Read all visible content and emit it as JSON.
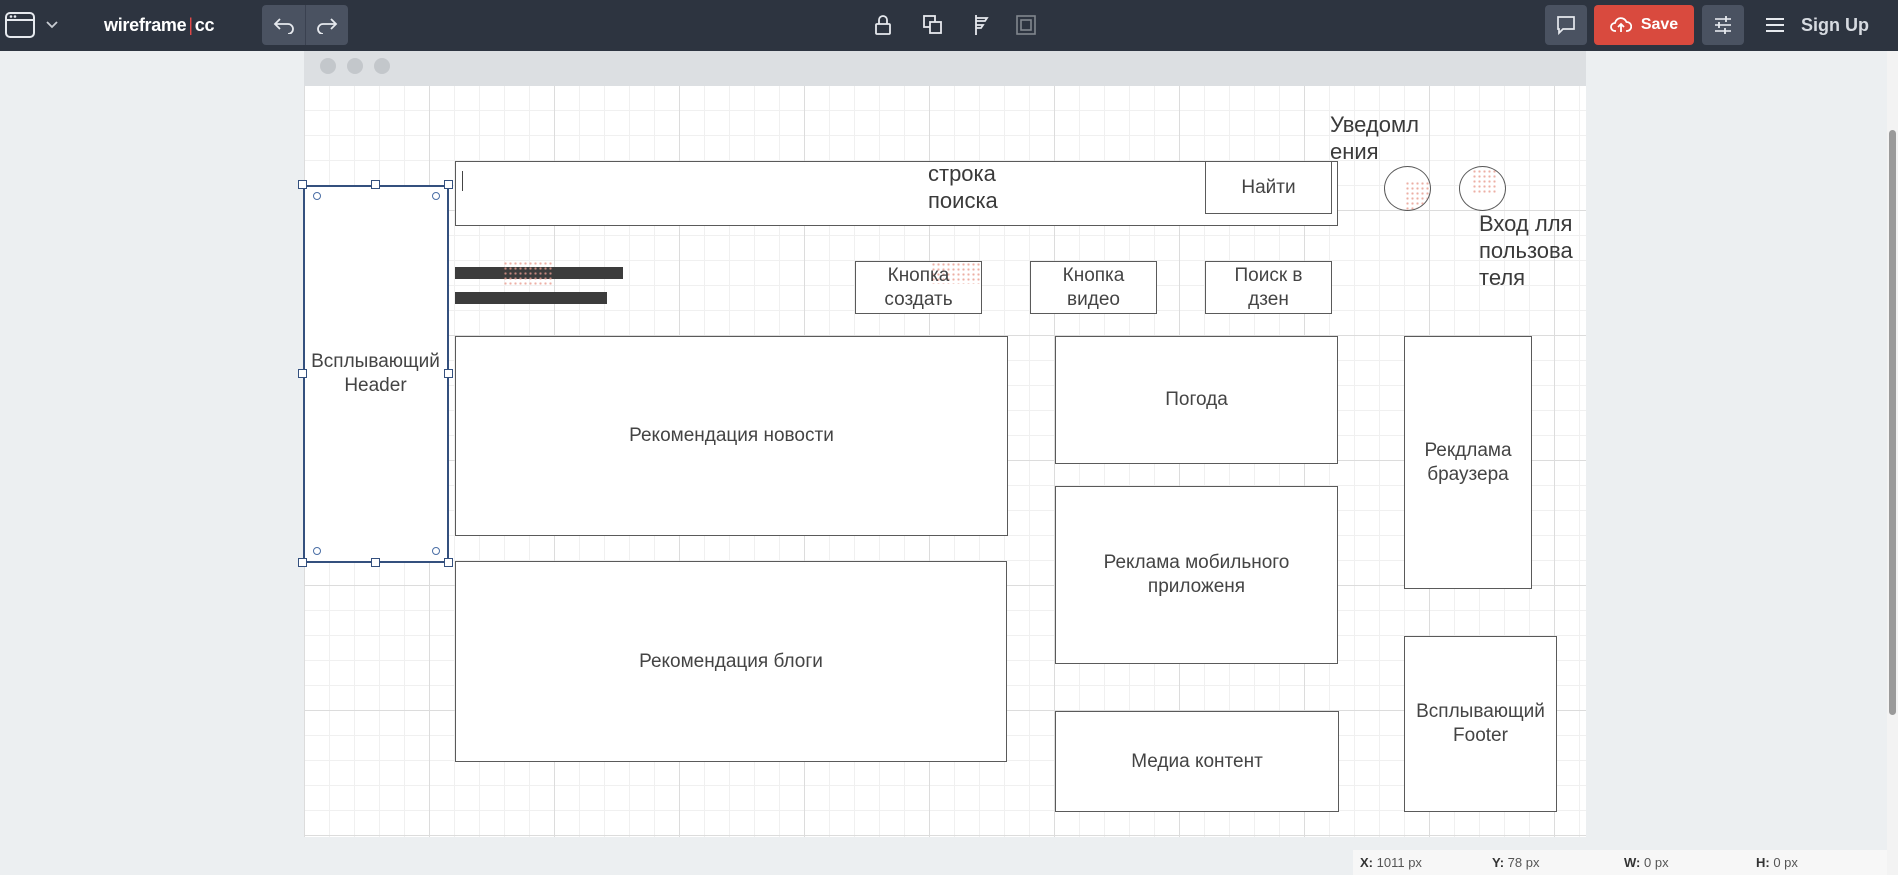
{
  "toolbar": {
    "brand_left": "wireframe",
    "brand_sep": "|",
    "brand_right": "cc",
    "save_label": "Save",
    "signup_label": "Sign Up",
    "icons": [
      "window-icon",
      "chevron-down-icon",
      "undo-icon",
      "redo-icon",
      "lock-icon",
      "arrange-icon",
      "align-icon",
      "group-icon",
      "comment-icon",
      "cloud-upload-icon",
      "sliders-icon",
      "hamburger-icon"
    ]
  },
  "colors": {
    "toolbar_bg": "#2d3440",
    "save_button": "#d94a3e",
    "selection": "#34507e"
  },
  "wireframe": {
    "popup_header": [
      "Всплывающий",
      "Header"
    ],
    "search_field": [
      "строка",
      "поиска"
    ],
    "search_button": "Найти",
    "notifications": [
      "Уведомл",
      "ения"
    ],
    "login": [
      "Вход лля",
      "пользова",
      "теля"
    ],
    "create_button": [
      "Кнопка",
      "создать"
    ],
    "video_button": [
      "Кнопка",
      "видео"
    ],
    "zen_search_button": [
      "Поиск в",
      "дзен"
    ],
    "news": "Рекомендация новости",
    "blogs": "Рекомендация блоги",
    "weather": "Погода",
    "mobile_ad": [
      "Реклама мобильного",
      "приложеня"
    ],
    "media": "Медиа контент",
    "browser_ad": [
      "Рекдлама",
      "браузера"
    ],
    "popup_footer": [
      "Всплывающий",
      "Footer"
    ]
  },
  "status": {
    "x_label": "X:",
    "x_value": "1011 px",
    "y_label": "Y:",
    "y_value": "78 px",
    "w_label": "W:",
    "w_value": "0 px",
    "h_label": "H:",
    "h_value": "0 px"
  }
}
